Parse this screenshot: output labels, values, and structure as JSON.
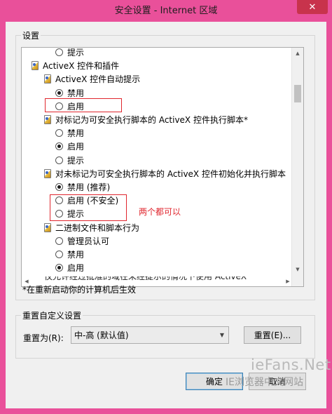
{
  "window": {
    "title": "安全设置 - Internet 区域",
    "close_glyph": "✕"
  },
  "settings_group": {
    "legend": "设置",
    "rows": [
      {
        "kind": "radio",
        "label": "提示",
        "checked": false
      },
      {
        "kind": "category",
        "label": "ActiveX 控件和插件"
      },
      {
        "kind": "setting",
        "label": "ActiveX 控件自动提示"
      },
      {
        "kind": "radio",
        "label": "禁用",
        "checked": true
      },
      {
        "kind": "radio",
        "label": "启用",
        "checked": false
      },
      {
        "kind": "setting",
        "label": "对标记为可安全执行脚本的 ActiveX 控件执行脚本*"
      },
      {
        "kind": "radio",
        "label": "禁用",
        "checked": false
      },
      {
        "kind": "radio",
        "label": "启用",
        "checked": true
      },
      {
        "kind": "radio",
        "label": "提示",
        "checked": false
      },
      {
        "kind": "setting",
        "label": "对未标记为可安全执行脚本的 ActiveX 控件初始化并执行脚本"
      },
      {
        "kind": "radio",
        "label": "禁用 (推荐)",
        "checked": true
      },
      {
        "kind": "radio",
        "label": "启用 (不安全)",
        "checked": false
      },
      {
        "kind": "radio",
        "label": "提示",
        "checked": false
      },
      {
        "kind": "setting",
        "label": "二进制文件和脚本行为"
      },
      {
        "kind": "radio",
        "label": "管理员认可",
        "checked": false
      },
      {
        "kind": "radio",
        "label": "禁用",
        "checked": false
      },
      {
        "kind": "radio",
        "label": "启用",
        "checked": true
      }
    ],
    "clipped_row": "仅允许经过批准的域在未经提示的情况下使用 ActiveX",
    "note": "*在重新启动你的计算机后生效"
  },
  "annotation": {
    "text": "两个都可以",
    "color": "#e0262e"
  },
  "reset_group": {
    "legend": "重置自定义设置",
    "reset_to_label": "重置为(R):",
    "selected_level": "中-高 (默认值)",
    "reset_button": "重置(E)..."
  },
  "buttons": {
    "ok": "确定",
    "cancel": "取消"
  },
  "watermark": {
    "site": "ieFans.Net",
    "caption": "IE浏览器中文网站"
  },
  "colors": {
    "window_frame": "#e9509a",
    "close_button": "#c8334c",
    "highlight": "#e0262e"
  }
}
